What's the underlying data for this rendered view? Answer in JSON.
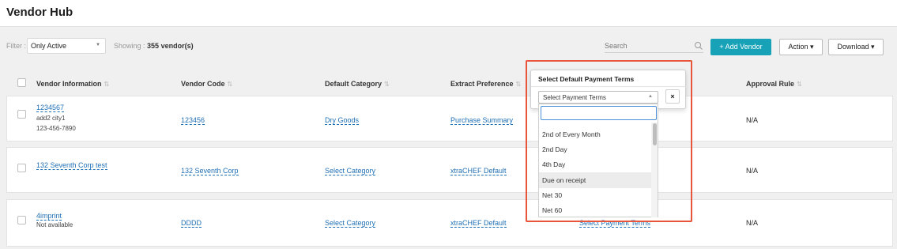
{
  "page": {
    "title": "Vendor Hub"
  },
  "toolbar": {
    "filter_label": "Filter :",
    "filter_value": "Only Active",
    "showing_label": "Showing :",
    "showing_value": "355 vendor(s)",
    "search_placeholder": "Search",
    "add_vendor": "+ Add Vendor",
    "action": "Action ▾",
    "download": "Download ▾"
  },
  "table": {
    "headers": {
      "vendor_information": "Vendor Information",
      "vendor_code": "Vendor Code",
      "default_category": "Default Category",
      "extract_preference": "Extract Preference",
      "approval_rule": "Approval Rule"
    },
    "sort_glyph": "⇅",
    "rows": [
      {
        "name": "1234567",
        "address": "add2 city1",
        "phone": "123-456-7890",
        "code": "123456",
        "category": "Dry Goods",
        "extract": "Purchase Summary",
        "approval": "N/A"
      },
      {
        "name": "132 Seventh Corp test",
        "code": "132 Seventh Corp",
        "category": "Select Category",
        "extract": "xtraCHEF Default",
        "approval": "N/A"
      },
      {
        "name": "4imprint",
        "address": "Not available",
        "code": "DDDD",
        "category": "Select Category",
        "extract": "xtraCHEF Default",
        "payment_terms": "Select Payment Terms",
        "approval": "N/A"
      }
    ]
  },
  "popover": {
    "title": "Select Default Payment Terms",
    "select_value": "Select Payment Terms",
    "close": "×",
    "options": [
      "2nd of Every Month",
      "2nd Day",
      "4th Day",
      "Due on receipt",
      "Net 30",
      "Net 60"
    ],
    "highlighted": "Due on receipt"
  },
  "colors": {
    "accent": "#17a2b8",
    "link": "#1f6fb5",
    "highlight_border": "#e8553a"
  }
}
